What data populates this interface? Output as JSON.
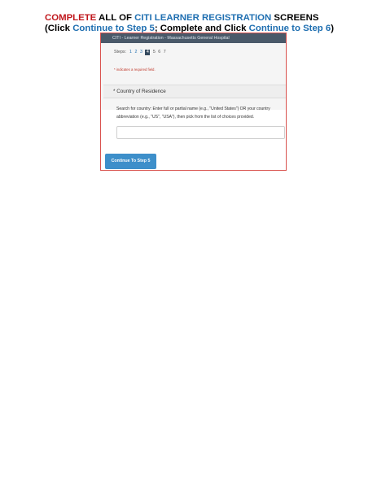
{
  "heading": {
    "line1": {
      "complete": "COMPLETE",
      "all_of": " ALL OF ",
      "citi": "CITI LEARNER REGISTRATION",
      "screens": " SCREENS"
    },
    "line2": {
      "open": "(Click ",
      "continue5": "Continue to Step 5",
      "mid": "; Complete and Click ",
      "continue6": "Continue to Step 6",
      "close": ")"
    }
  },
  "screenshot": {
    "window_title": "CITI - Learner Registration - Massachusetts General Hospital",
    "steps_label": "Steps:",
    "steps": [
      "1",
      "2",
      "3",
      "4",
      "5",
      "6",
      "7"
    ],
    "current_step": "4",
    "required_note": "* indicates a required field.",
    "section_title": "* Country of Residence",
    "instructions": "Search for country: Enter full or partial name (e.g., \"United States\") OR your country abbreviation (e.g., \"US\", \"USA\"), then pick from the list of choices provided.",
    "country_input_value": "",
    "continue_button": "Continue To Step 5"
  }
}
